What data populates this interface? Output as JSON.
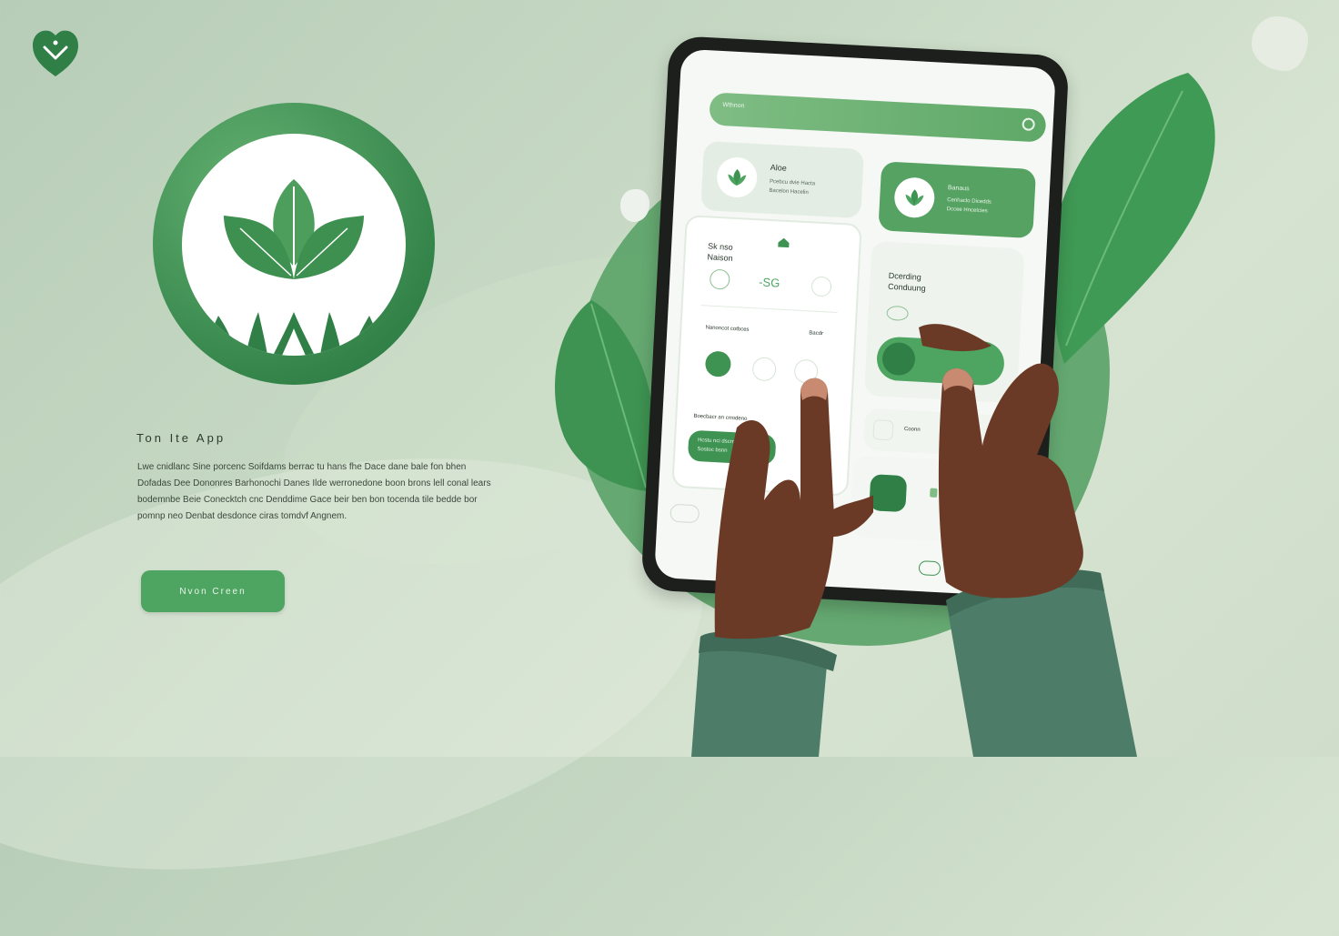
{
  "colors": {
    "background": "#c7d9c4",
    "brand_green": "#4ea561",
    "dark_green": "#2f7f46",
    "skin": "#6b3a26",
    "sleeve": "#4d7c68"
  },
  "icons": {
    "logo_badge": "heart-check-icon",
    "big_logo": "leaf-sprout-icon",
    "search": "search-icon",
    "home": "home-icon"
  },
  "hero": {
    "title": "Ton Ite App",
    "body": "Lwe cnidlanc Sine porcenc Soifdams berrac tu hans fhe Dace dane bale fon bhen Dofadas Dee Dononres Barhonochi Danes Ilde werronedone boon brons lell conal lears bodemnbe Beie Conecktch cnc Denddime Gace beir ben bon tocenda tile bedde bor pomnp neo Denbat desdonce ciras tomdvf Angnem.",
    "cta_label": "Nvon Creen"
  },
  "tablet": {
    "search_placeholder": "Wthnon",
    "card1": {
      "title": "Aloe",
      "line1": "Pcebcu dvie Hacta",
      "line2": "Bacelon Hacelin"
    },
    "card2": {
      "title": "Banaus",
      "line1": "Cenhaclo Dicedds",
      "line2": "Dccee Hncetcies"
    },
    "card3": {
      "title_line1": "Sk nso",
      "title_line2": "Naison",
      "value": "-SG",
      "row_label": "Nanoncot cotbces",
      "row_right": "Bacdr",
      "footer_label": "Boecbacr an crrodeno",
      "button_line1": "Hcstu nci dscrng",
      "button_line2": "Sostoc bsnn"
    },
    "card4": {
      "title_line1": "Dcerding",
      "title_line2": "Conduung"
    },
    "card5": {
      "label": "Coonn"
    }
  }
}
